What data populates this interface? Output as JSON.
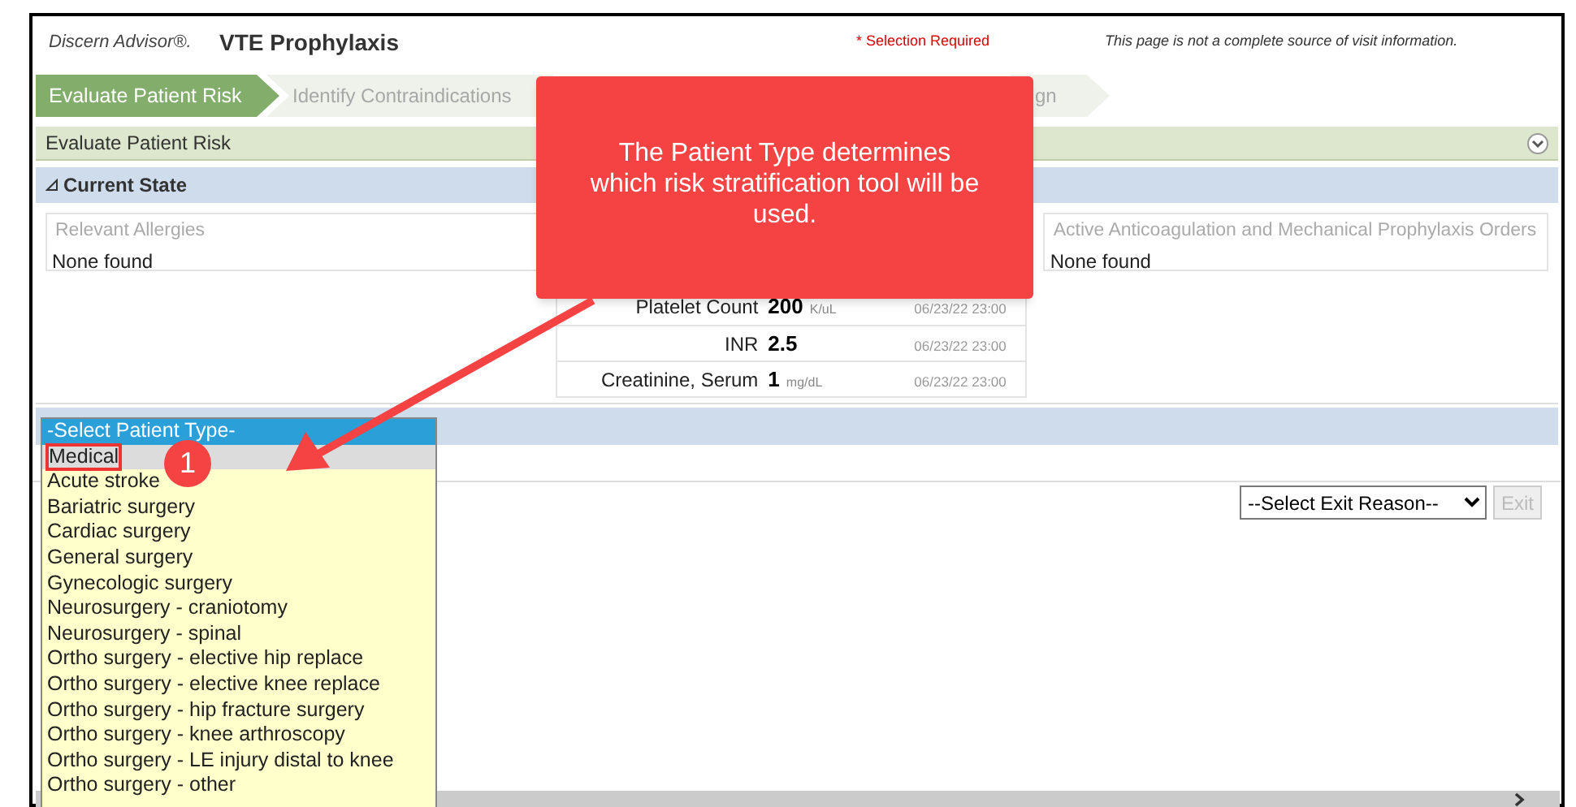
{
  "header": {
    "brand": "Discern Advisor®.",
    "title": "VTE Prophylaxis",
    "required_note": "* Selection Required",
    "disclaimer": "This page is not a complete source of visit information."
  },
  "tabs": [
    {
      "label": "Evaluate Patient Risk",
      "selected": true
    },
    {
      "label": "Identify Contraindications",
      "selected": false
    },
    {
      "label": "gn",
      "selected": false
    }
  ],
  "section_bar": {
    "title": "Evaluate Patient Risk",
    "expanded": true
  },
  "current_state": {
    "title": "Current State",
    "expanded": true,
    "allergies": {
      "legend": "Relevant Allergies",
      "value": "None found"
    },
    "labs": [
      {
        "name": "Platelet Count",
        "value": "200",
        "unit": "K/uL",
        "time": "06/23/22 23:00"
      },
      {
        "name": "INR",
        "value": "2.5",
        "time": "06/23/22 23:00"
      },
      {
        "name": "Creatinine, Serum",
        "value": "1",
        "unit": "mg/dL",
        "time": "06/23/22 23:00"
      }
    ],
    "orders": {
      "legend": "Active Anticoagulation and Mechanical Prophylaxis Orders",
      "value": "None found"
    }
  },
  "patient_type_dropdown": {
    "options": [
      {
        "label": "-Select Patient Type-",
        "selected": true,
        "highlighted": false
      },
      {
        "label": "Medical",
        "selected": false,
        "highlighted": true
      },
      {
        "label": "Acute stroke",
        "selected": false,
        "highlighted": false
      },
      {
        "label": "Bariatric surgery",
        "selected": false,
        "highlighted": false
      },
      {
        "label": "Cardiac surgery",
        "selected": false,
        "highlighted": false
      },
      {
        "label": "General surgery",
        "selected": false,
        "highlighted": false
      },
      {
        "label": "Gynecologic surgery",
        "selected": false,
        "highlighted": false
      },
      {
        "label": "Neurosurgery - craniotomy",
        "selected": false,
        "highlighted": false
      },
      {
        "label": "Neurosurgery - spinal",
        "selected": false,
        "highlighted": false
      },
      {
        "label": "Ortho surgery - elective hip replace",
        "selected": false,
        "highlighted": false
      },
      {
        "label": "Ortho surgery - elective knee replace",
        "selected": false,
        "highlighted": false
      },
      {
        "label": "Ortho surgery - hip fracture surgery",
        "selected": false,
        "highlighted": false
      },
      {
        "label": "Ortho surgery - knee arthroscopy",
        "selected": false,
        "highlighted": false
      },
      {
        "label": "Ortho surgery - LE injury distal to knee",
        "selected": false,
        "highlighted": false
      },
      {
        "label": "Ortho surgery - other",
        "selected": false,
        "highlighted": false
      }
    ]
  },
  "exit": {
    "placeholder": "--Select Exit Reason--",
    "button": "Exit",
    "disabled": true
  },
  "callout": {
    "text": "The Patient Type determines which risk stratification tool will be used.",
    "marker": "1"
  }
}
